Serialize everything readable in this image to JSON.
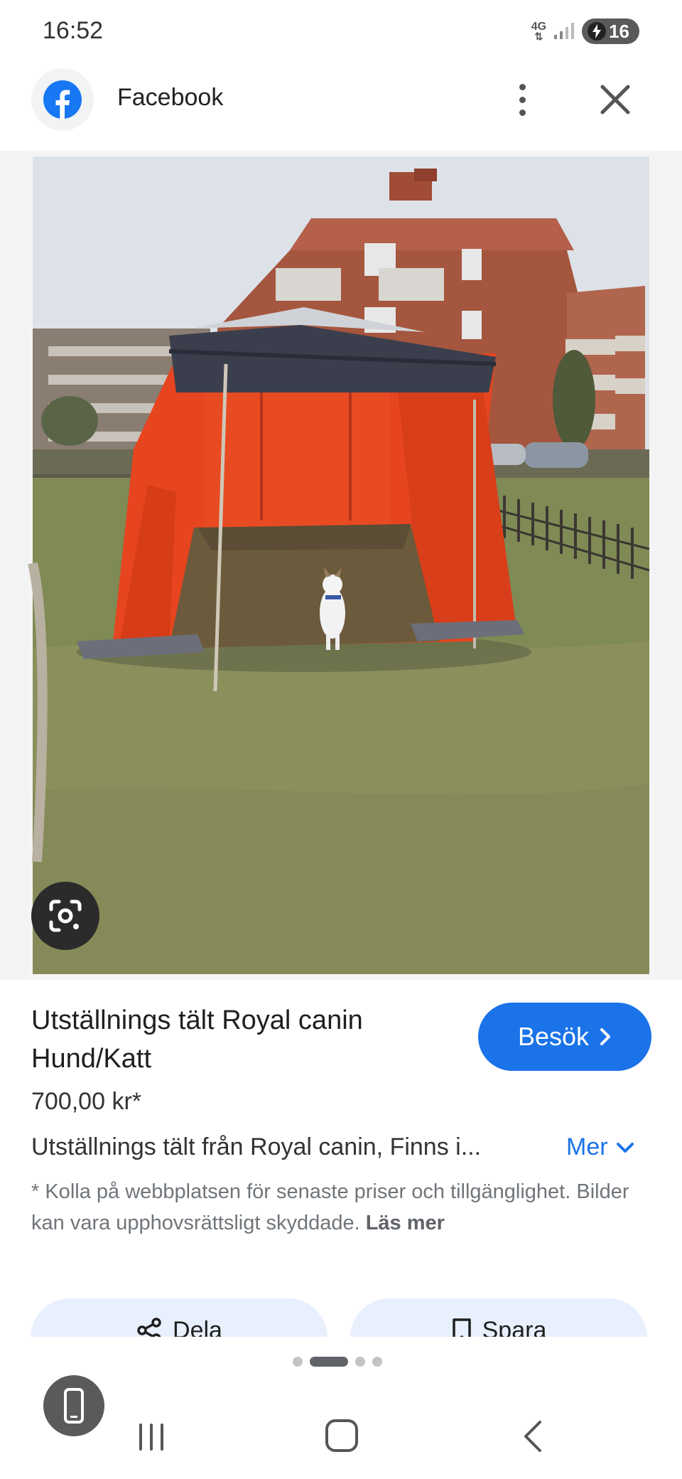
{
  "status_bar": {
    "time": "16:52",
    "network": "4G",
    "battery_level": "16"
  },
  "app_bar": {
    "title": "Facebook"
  },
  "image": {
    "alt": "Orange exhibition tent on grass with a small dog inside, brick apartment buildings behind"
  },
  "product": {
    "title": "Utställnings tält Royal canin Hund/Katt",
    "visit_label": "Besök",
    "price": "700,00 kr*",
    "description": "Utställnings tält från Royal canin, Finns i...",
    "more_label": "Mer",
    "disclaimer": "* Kolla på webbplatsen för senaste priser och tillgänglighet. Bilder kan vara upphovsrättsligt skyddade.",
    "read_more_label": "Läs mer"
  },
  "actions": {
    "share_label": "Dela",
    "save_label": "Spara"
  },
  "colors": {
    "accent": "#1a73e8",
    "facebook_blue": "#1877f2",
    "chip_background": "#e8f0fe"
  }
}
